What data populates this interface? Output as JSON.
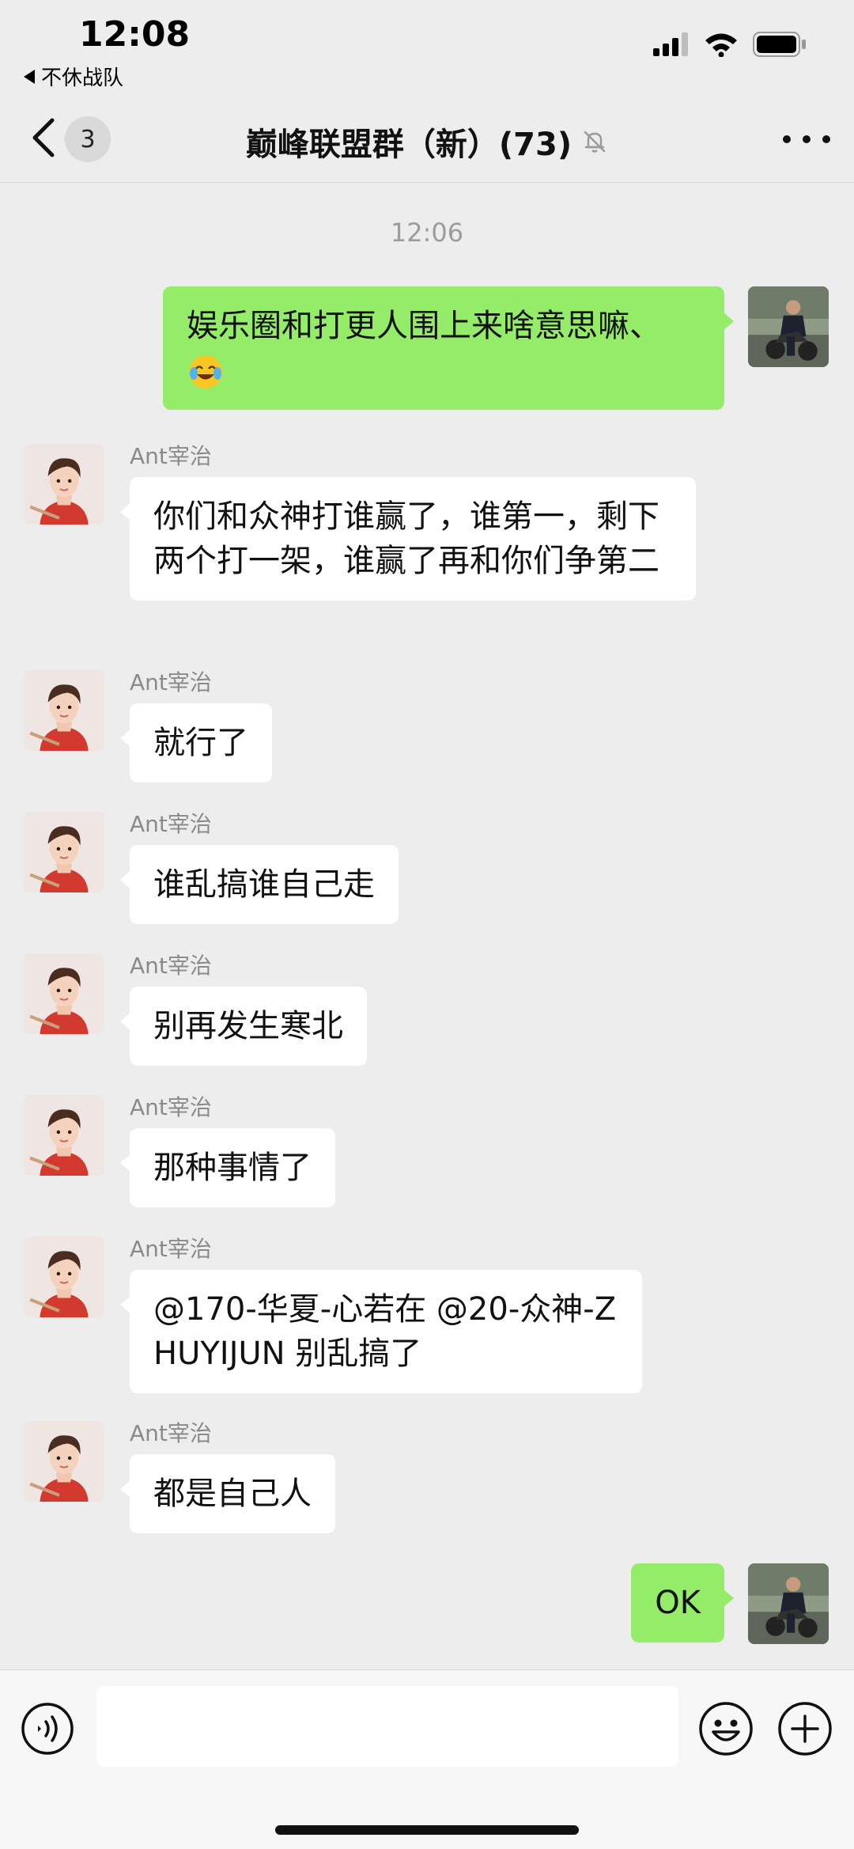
{
  "status_bar": {
    "time": "12:08",
    "back_app": "不休战队"
  },
  "nav": {
    "unread_count": "3",
    "title": "巅峰联盟群（新）(73)",
    "muted": true
  },
  "chat": {
    "timestamp": "12:06",
    "messages": [
      {
        "side": "right",
        "text": "娱乐圈和打更人围上来啥意思嘛、",
        "emoji": "crying-laughing-emoji"
      },
      {
        "side": "left",
        "sender": "Ant宰治",
        "text": "你们和众神打谁赢了，谁第一，剩下两个打一架，谁赢了再和你们争第二"
      },
      {
        "side": "left",
        "sender": "Ant宰治",
        "text": "就行了"
      },
      {
        "side": "left",
        "sender": "Ant宰治",
        "text": "谁乱搞谁自己走"
      },
      {
        "side": "left",
        "sender": "Ant宰治",
        "text": "别再发生寒北"
      },
      {
        "side": "left",
        "sender": "Ant宰治",
        "text": "那种事情了"
      },
      {
        "side": "left",
        "sender": "Ant宰治",
        "text": "@170-华夏-心若在 @20-众神-ZHUYIJUN 别乱搞了"
      },
      {
        "side": "left",
        "sender": "Ant宰治",
        "text": "都是自己人"
      },
      {
        "side": "right",
        "text": "OK"
      }
    ]
  },
  "input_bar": {
    "value": "",
    "placeholder": ""
  },
  "colors": {
    "background": "#ededed",
    "outgoing_bubble": "#95ec69",
    "incoming_bubble": "#ffffff",
    "sender_name": "#8a8a8a"
  }
}
